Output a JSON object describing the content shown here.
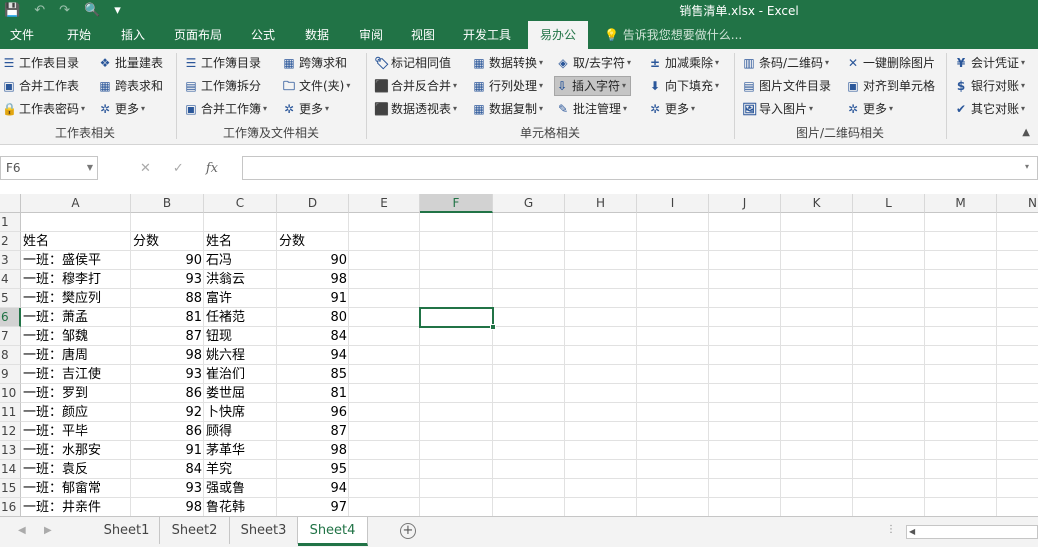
{
  "title": "销售清单.xlsx - Excel",
  "qat": [
    "save-icon",
    "undo-icon",
    "redo-icon",
    "print-preview-icon",
    "customize-icon"
  ],
  "tabs": [
    "文件",
    "开始",
    "插入",
    "页面布局",
    "公式",
    "数据",
    "审阅",
    "视图",
    "开发工具",
    "易办公"
  ],
  "active_tab": "易办公",
  "tell_me": "告诉我您想要做什么...",
  "ribbon": {
    "groups": [
      "工作表相关",
      "工作簿及文件相关",
      "单元格相关",
      "图片/二维码相关"
    ],
    "g1": [
      "工作表目录",
      "批量建表",
      "合并工作表",
      "跨表求和",
      "工作表密码",
      "更多"
    ],
    "g2": [
      "工作簿目录",
      "跨簿求和",
      "工作簿拆分",
      "文件(夹)",
      "合并工作簿",
      "更多"
    ],
    "g3": [
      "标记相同值",
      "数据转换",
      "取/去字符",
      "加减乘除",
      "合并反合并",
      "行列处理",
      "插入字符",
      "向下填充",
      "数据透视表",
      "数据复制",
      "批注管理",
      "更多"
    ],
    "g4": [
      "条码/二维码",
      "一键删除图片",
      "图片文件目录",
      "对齐到单元格",
      "导入图片",
      "更多"
    ],
    "g5": [
      "会计凭证",
      "银行对账",
      "其它对账"
    ]
  },
  "namebox": "F6",
  "formula": "",
  "columns": [
    "A",
    "B",
    "C",
    "D",
    "E",
    "F",
    "G",
    "H",
    "I",
    "J",
    "K",
    "L",
    "M",
    "N"
  ],
  "selected_column": "F",
  "selected_row": "6",
  "rows": [
    {
      "n": "1",
      "a": "",
      "b": "",
      "c": "",
      "d": ""
    },
    {
      "n": "2",
      "a": "姓名",
      "b": "分数",
      "c": "姓名",
      "d": "分数"
    },
    {
      "n": "3",
      "a": "一班：盛侯平",
      "b": "90",
      "c": "石冯",
      "d": "90"
    },
    {
      "n": "4",
      "a": "一班：穆李打",
      "b": "93",
      "c": "洪翁云",
      "d": "98"
    },
    {
      "n": "5",
      "a": "一班：樊应列",
      "b": "88",
      "c": "富许",
      "d": "91"
    },
    {
      "n": "6",
      "a": "一班：萧孟",
      "b": "81",
      "c": "任褚范",
      "d": "80"
    },
    {
      "n": "7",
      "a": "一班：邹魏",
      "b": "87",
      "c": "钮现",
      "d": "84"
    },
    {
      "n": "8",
      "a": "一班：唐周",
      "b": "98",
      "c": "姚六程",
      "d": "94"
    },
    {
      "n": "9",
      "a": "一班：吉江使",
      "b": "93",
      "c": "崔治们",
      "d": "85"
    },
    {
      "n": "10",
      "a": "一班：罗到",
      "b": "86",
      "c": "娄世屈",
      "d": "81"
    },
    {
      "n": "11",
      "a": "一班：颜应",
      "b": "92",
      "c": "卜快席",
      "d": "96"
    },
    {
      "n": "12",
      "a": "一班：平毕",
      "b": "86",
      "c": "顾得",
      "d": "87"
    },
    {
      "n": "13",
      "a": "一班：水那安",
      "b": "91",
      "c": "茅革华",
      "d": "98"
    },
    {
      "n": "14",
      "a": "一班：袁反",
      "b": "84",
      "c": "羊究",
      "d": "95"
    },
    {
      "n": "15",
      "a": "一班：郁畲常",
      "b": "93",
      "c": "强或鲁",
      "d": "94"
    },
    {
      "n": "16",
      "a": "一班：井亲件",
      "b": "98",
      "c": "鲁花韩",
      "d": "97"
    }
  ],
  "sheets": [
    "Sheet1",
    "Sheet2",
    "Sheet3",
    "Sheet4"
  ],
  "active_sheet": "Sheet4",
  "colors": {
    "accent": "#217346",
    "ribbon_bg": "#f3f3f3",
    "grid_line": "#e1e1e1"
  }
}
